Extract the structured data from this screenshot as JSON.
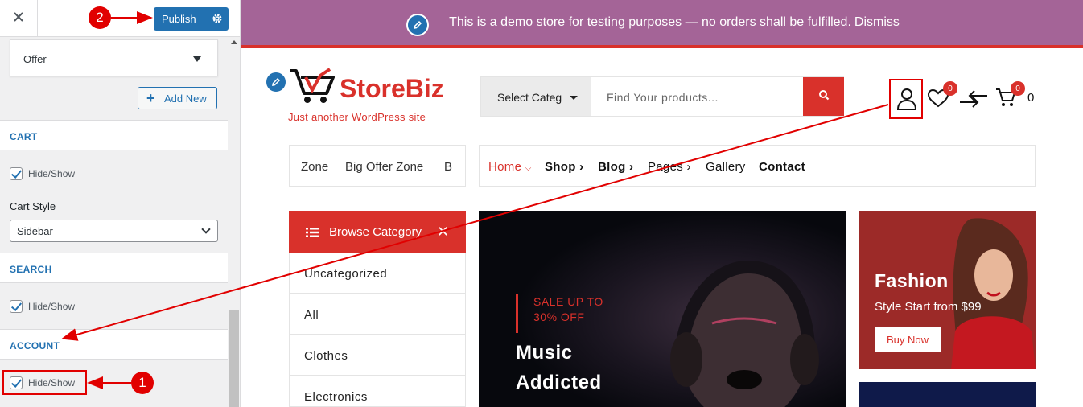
{
  "customizer": {
    "publish_label": "Publish",
    "menu_select_value": "Offer",
    "add_new_label": "Add New",
    "sections": {
      "cart": {
        "title": "CART",
        "toggle_label": "Hide/Show",
        "style_label": "Cart Style",
        "style_value": "Sidebar"
      },
      "search": {
        "title": "SEARCH",
        "toggle_label": "Hide/Show"
      },
      "account": {
        "title": "ACCOUNT",
        "toggle_label": "Hide/Show"
      }
    }
  },
  "annotations": {
    "step1": "1",
    "step2": "2",
    "color": "#e10000"
  },
  "store": {
    "demo_notice": "This is a demo store for testing purposes — no orders shall be fulfilled.",
    "dismiss_label": "Dismiss",
    "logo_text": "StoreBiz",
    "tagline": "Just another WordPress site",
    "search": {
      "category_label": "Select Categ",
      "placeholder": "Find Your products..."
    },
    "wishlist_count": "0",
    "cart_badge": "0",
    "cart_total": "0",
    "offer_strip": [
      "Zone",
      "Big Offer Zone",
      "B"
    ],
    "nav": [
      "Home",
      "Shop",
      "Blog",
      "Pages",
      "Gallery",
      "Contact"
    ],
    "browse_label": "Browse Category",
    "categories": [
      "Uncategorized",
      "All",
      "Clothes",
      "Electronics"
    ],
    "hero": {
      "sale_line1": "SALE UP TO",
      "sale_line2": "30% OFF",
      "title_line1": "Music",
      "title_line2": "Addicted"
    },
    "promo": {
      "title": "Fashion",
      "subtitle": "Style Start from $99",
      "button": "Buy Now"
    },
    "colors": {
      "accent": "#d9312b",
      "notice_bg": "#a46497",
      "wp_blue": "#2271b1"
    }
  }
}
